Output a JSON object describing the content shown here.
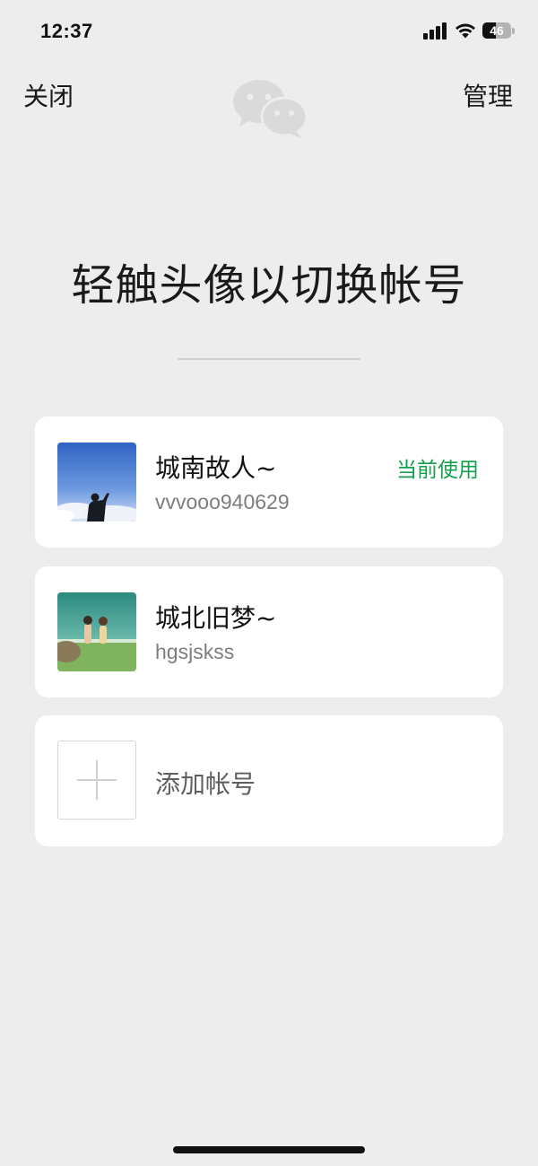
{
  "status_bar": {
    "time": "12:37",
    "battery_level": "46",
    "battery_fraction": 0.46,
    "signal_bars": 4,
    "wifi": true
  },
  "header": {
    "close_label": "关闭",
    "manage_label": "管理",
    "logo_icon": "wechat-logo-icon"
  },
  "title": "轻触头像以切换帐号",
  "accounts": [
    {
      "name": "城南故人~",
      "id": "vvvooo940629",
      "badge": "当前使用"
    },
    {
      "name": "城北旧梦~",
      "id": "hgsjskss"
    }
  ],
  "add_account": {
    "label": "添加帐号",
    "icon": "plus-icon"
  },
  "colors": {
    "background": "#ededed",
    "card": "#ffffff",
    "accent_green": "#14a04d",
    "secondary_text": "#7d7d7d"
  }
}
